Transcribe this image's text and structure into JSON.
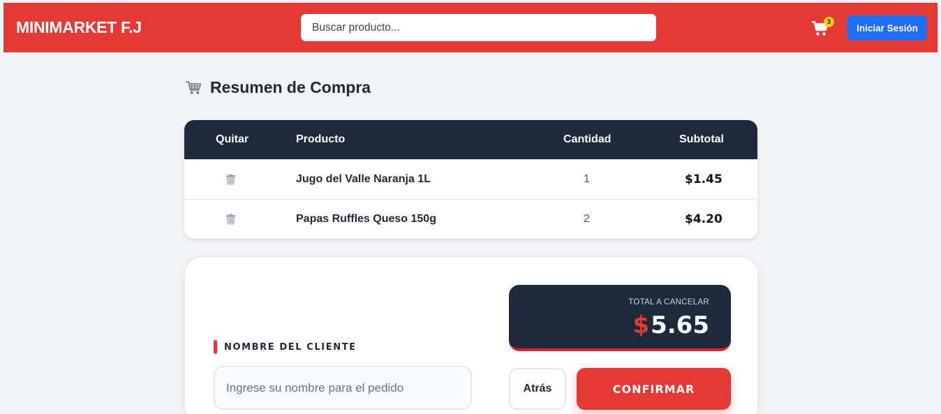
{
  "header": {
    "brand": "MINIMARKET F.J",
    "search_placeholder": "Buscar producto...",
    "cart_count": "3",
    "login_label": "Iniciar Sesión",
    "accent_color": "#e53935"
  },
  "summary": {
    "title": "Resumen de Compra",
    "title_icon": "shopping-cart-icon"
  },
  "table": {
    "columns": [
      "Quitar",
      "Producto",
      "Cantidad",
      "Subtotal"
    ],
    "rows": [
      {
        "product": "Jugo del Valle Naranja 1L",
        "quantity": "1",
        "subtotal": "$1.45"
      },
      {
        "product": "Papas Ruffles Queso 150g",
        "quantity": "2",
        "subtotal": "$4.20"
      }
    ]
  },
  "checkout": {
    "name_label": "NOMBRE DEL CLIENTE",
    "name_placeholder": "Ingrese su nombre para el pedido",
    "total_label": "TOTAL A CANCELAR",
    "total_currency": "$",
    "total_amount": "5.65",
    "back_label": "Atrás",
    "confirm_label": "CONFIRMAR"
  }
}
